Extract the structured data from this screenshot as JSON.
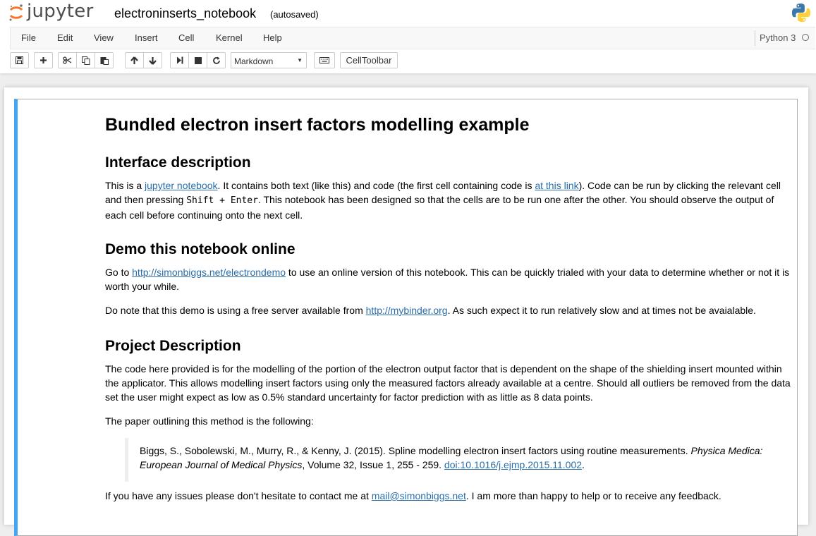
{
  "header": {
    "logo_text": "jupyter",
    "notebook_name": "electroninserts_notebook",
    "autosave": "(autosaved)"
  },
  "menu": [
    "File",
    "Edit",
    "View",
    "Insert",
    "Cell",
    "Kernel",
    "Help"
  ],
  "kernel": {
    "name": "Python 3",
    "indicator": "kernel-idle-icon"
  },
  "toolbar": {
    "buttons": [
      "save-icon",
      "plus-icon",
      "cut-icon",
      "copy-icon",
      "paste-icon",
      "arrow-up-icon",
      "arrow-down-icon",
      "step-forward-icon",
      "stop-icon",
      "refresh-icon",
      "keyboard-icon"
    ],
    "cell_type": "Markdown",
    "celltoolbar_label": "CellToolbar"
  },
  "content": {
    "h1": "Bundled electron insert factors modelling example",
    "s1": {
      "heading": "Interface description",
      "p1_a": "This is a ",
      "p1_link1": "jupyter notebook",
      "p1_b": ". It contains both text (like this) and code (the first cell containing code is ",
      "p1_link2": "at this link",
      "p1_c": "). Code can be run by clicking the relevant cell and then pressing ",
      "p1_code": "Shift + Enter",
      "p1_d": ". This notebook has been designed so that the cells are to be run one after the other. You should observe the output of each cell before continuing onto the next cell."
    },
    "s2": {
      "heading": "Demo this notebook online",
      "p1_a": "Go to ",
      "p1_link": "http://simonbiggs.net/electrondemo",
      "p1_b": " to use an online version of this notebook. This can be quickly trialed with your data to determine whether or not it is worth your while.",
      "p2_a": "Do note that this demo is using a free server available from ",
      "p2_link": "http://mybinder.org",
      "p2_b": ". As such expect it to run relatively slow and at times not be avaialable."
    },
    "s3": {
      "heading": "Project Description",
      "p1": "The code here provided is for the modelling of the portion of the electron output factor that is dependent on the shape of the shielding insert mounted within the applicator. This allows modelling insert factors using only the measured factors already available at a centre. Should all outliers be removed from the data set the user might expect as low as 0.5% standard uncertainty for factor prediction with as little as 8 data points.",
      "p2": "The paper outlining this method is the following:",
      "quote_a": "Biggs, S., Sobolewski, M., Murry, R., & Kenny, J. (2015). Spline modelling electron insert factors using routine measurements. ",
      "quote_journal": "Physica Medica: European Journal of Medical Physics",
      "quote_b": ", Volume 32, Issue 1, 255 - 259. ",
      "quote_link": "doi:10.1016/j.ejmp.2015.11.002",
      "quote_c": ".",
      "p3_a": "If you have any issues please don't hesitate to contact me at ",
      "p3_link": "mail@simonbiggs.net",
      "p3_b": ". I am more than happy to help or to receive any feedback."
    }
  }
}
